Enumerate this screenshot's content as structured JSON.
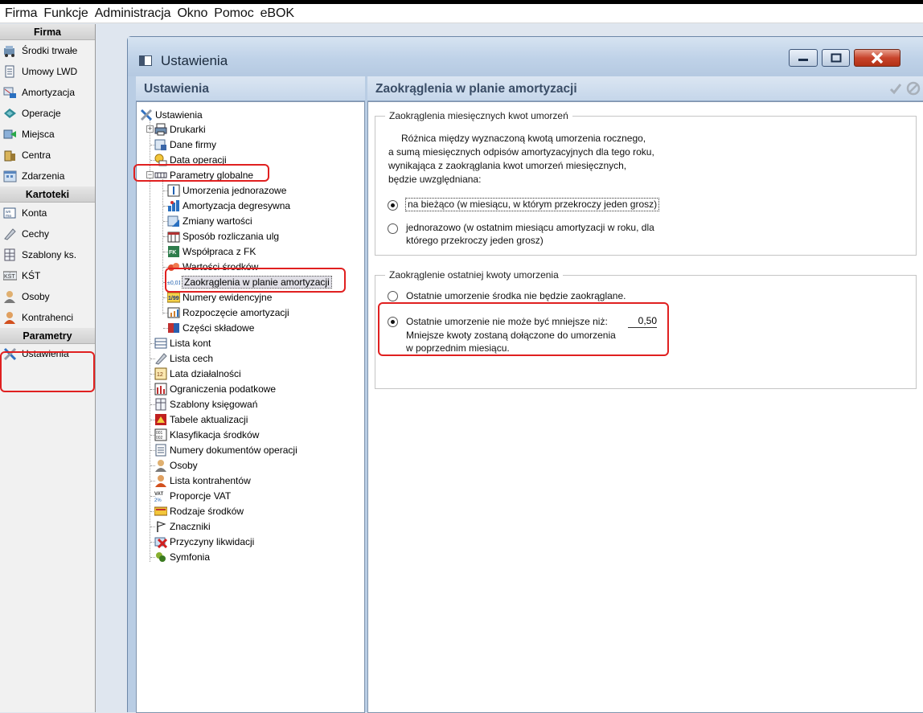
{
  "menu": [
    "Firma",
    "Funkcje",
    "Administracja",
    "Okno",
    "Pomoc",
    "eBOK"
  ],
  "nav": {
    "sections": [
      {
        "title": "Firma",
        "items": [
          "Środki trwałe",
          "Umowy LWD",
          "Amortyzacja",
          "Operacje",
          "Miejsca",
          "Centra",
          "Zdarzenia"
        ]
      },
      {
        "title": "Kartoteki",
        "items": [
          "Konta",
          "Cechy",
          "Szablony ks.",
          "KŚT",
          "Osoby",
          "Kontrahenci"
        ]
      },
      {
        "title": "Parametry",
        "items": [
          "Ustawienia"
        ]
      }
    ]
  },
  "window": {
    "title": "Ustawienia",
    "left_header": "Ustawienia",
    "right_header": "Zaokrąglenia w planie amortyzacji"
  },
  "tree": {
    "root": "Ustawienia",
    "items": [
      "Drukarki",
      "Dane firmy",
      "Data operacji",
      "Parametry globalne",
      "Umorzenia jednorazowe",
      "Amortyzacja degresywna",
      "Zmiany wartości",
      "Sposób rozliczania ulg",
      "Współpraca z FK",
      "Wartości środków",
      "Zaokrąglenia w planie amortyzacji",
      "Numery ewidencyjne",
      "Rozpoczęcie amortyzacji",
      "Części składowe",
      "Lista kont",
      "Lista cech",
      "Lata działalności",
      "Ograniczenia podatkowe",
      "Szablony księgowań",
      "Tabele aktualizacji",
      "Klasyfikacja środków",
      "Numery dokumentów operacji",
      "Osoby",
      "Lista kontrahentów",
      "Proporcje VAT",
      "Rodzaje środków",
      "Znaczniki",
      "Przyczyny likwidacji",
      "Symfonia"
    ]
  },
  "content": {
    "group1": {
      "title": "Zaokrąglenia miesięcznych kwot umorzeń",
      "description": [
        "Różnica między wyznaczoną kwotą umorzenia rocznego,",
        "a sumą miesięcznych odpisów amortyzacyjnych dla tego roku,",
        "wynikająca z zaokrąglania kwot umorzeń miesięcznych,",
        "będzie uwzględniana:"
      ],
      "option1": "na bieżąco (w miesiącu, w którym przekroczy jeden grosz)",
      "option2_line1": "jednorazowo (w ostatnim miesiącu amortyzacji w roku, dla",
      "option2_line2": "którego przekroczy jeden grosz)"
    },
    "group2": {
      "title": "Zaokrąglenie ostatniej kwoty umorzenia",
      "option1": "Ostatnie umorzenie środka nie będzie zaokrąglane.",
      "option2": "Ostatnie umorzenie nie może być mniejsze niż:",
      "value": "0,50",
      "note_line1": "Mniejsze kwoty zostaną dołączone do umorzenia",
      "note_line2": "w poprzednim miesiącu."
    }
  }
}
